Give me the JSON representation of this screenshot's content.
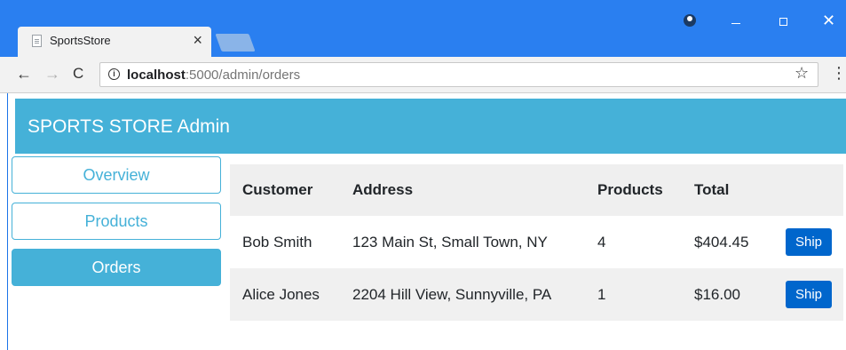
{
  "browser": {
    "tab_title": "SportsStore",
    "tab_close": "×",
    "url_host": "localhost",
    "url_path": ":5000/admin/orders",
    "back": "←",
    "forward": "→",
    "reload": "C",
    "star": "☆",
    "menu": "⋮",
    "info": "i",
    "window_close": "✕",
    "colors": {
      "titlebar": "#2a7ff0",
      "toolbar": "#f2f2f2"
    }
  },
  "app": {
    "title": "SPORTS STORE Admin",
    "accent": "#45b1d8"
  },
  "sidebar": {
    "items": [
      {
        "label": "Overview"
      },
      {
        "label": "Products"
      },
      {
        "label": "Orders"
      }
    ]
  },
  "orders": {
    "columns": [
      "Customer",
      "Address",
      "Products",
      "Total",
      ""
    ],
    "rows": [
      {
        "customer": "Bob Smith",
        "address": "123 Main St, Small Town, NY",
        "products": "4",
        "total": "$404.45",
        "action": "Ship"
      },
      {
        "customer": "Alice Jones",
        "address": "2204 Hill View, Sunnyville, PA",
        "products": "1",
        "total": "$16.00",
        "action": "Ship"
      }
    ]
  }
}
